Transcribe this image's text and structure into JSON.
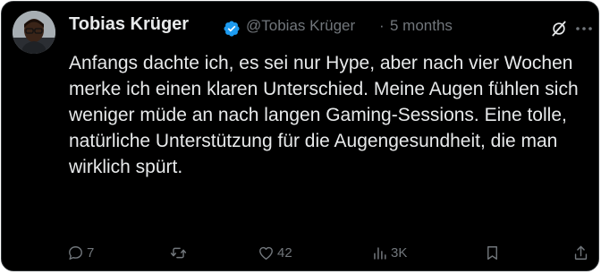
{
  "tweet": {
    "author_name": "Tobias Krüger",
    "handle": "@Tobias Krüger",
    "separator": "·",
    "timestamp": "5 months",
    "text": "Anfangs dachte ich, es sei nur Hype, aber nach vier Wochen merke ich einen klaren Unterschied. Meine Augen fühlen sich weniger müde an nach langen Gaming-Sessions. Eine tolle, natürliche Unterstützung für die Augengesundheit, die man wirklich spürt."
  },
  "actions": {
    "reply_count": "7",
    "retweet_count": "",
    "like_count": "42",
    "view_count": "3K"
  },
  "colors": {
    "background": "#000000",
    "text": "#e7e9ea",
    "muted": "#71767b",
    "verified": "#1d9bf0"
  },
  "icons": [
    "verified-badge-icon",
    "grok-icon",
    "more-icon",
    "reply-icon",
    "retweet-icon",
    "like-icon",
    "views-icon",
    "bookmark-icon",
    "share-icon"
  ]
}
